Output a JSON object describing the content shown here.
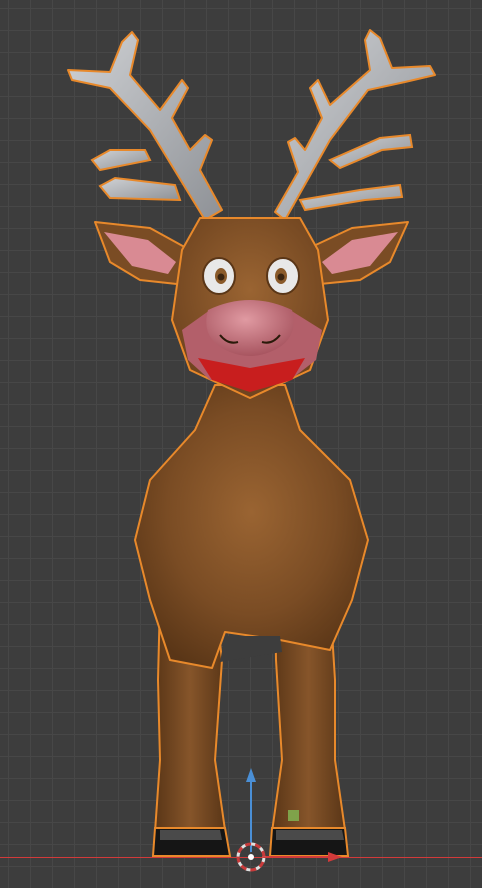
{
  "viewport": {
    "mode": "3d-viewport",
    "view": "front",
    "grid": true
  },
  "scene": {
    "object": "reindeer",
    "selected": true
  },
  "colors": {
    "background": "#3d3d3d",
    "grid_line": "#474747",
    "selection_outline": "#e8892b",
    "body_brown": "#7a4c24",
    "body_highlight": "#9a6432",
    "body_shadow": "#5a3617",
    "antler": "#b8bbbe",
    "antler_shadow": "#8e9196",
    "ear_inner": "#d98a93",
    "nose": "#c76b78",
    "mouth": "#c81e1e",
    "eye_white": "#e8e8e8",
    "pupil": "#3a2410",
    "hoof": "#151515",
    "x_axis": "#d23a3a",
    "z_axis": "#4a8fd6",
    "light_marker": "#7fa24a"
  },
  "gizmo": {
    "name": "3d-cursor-icon",
    "z_axis_arrow": "z-axis-arrow-icon",
    "x_axis_arrow": "x-axis-arrow-icon"
  }
}
